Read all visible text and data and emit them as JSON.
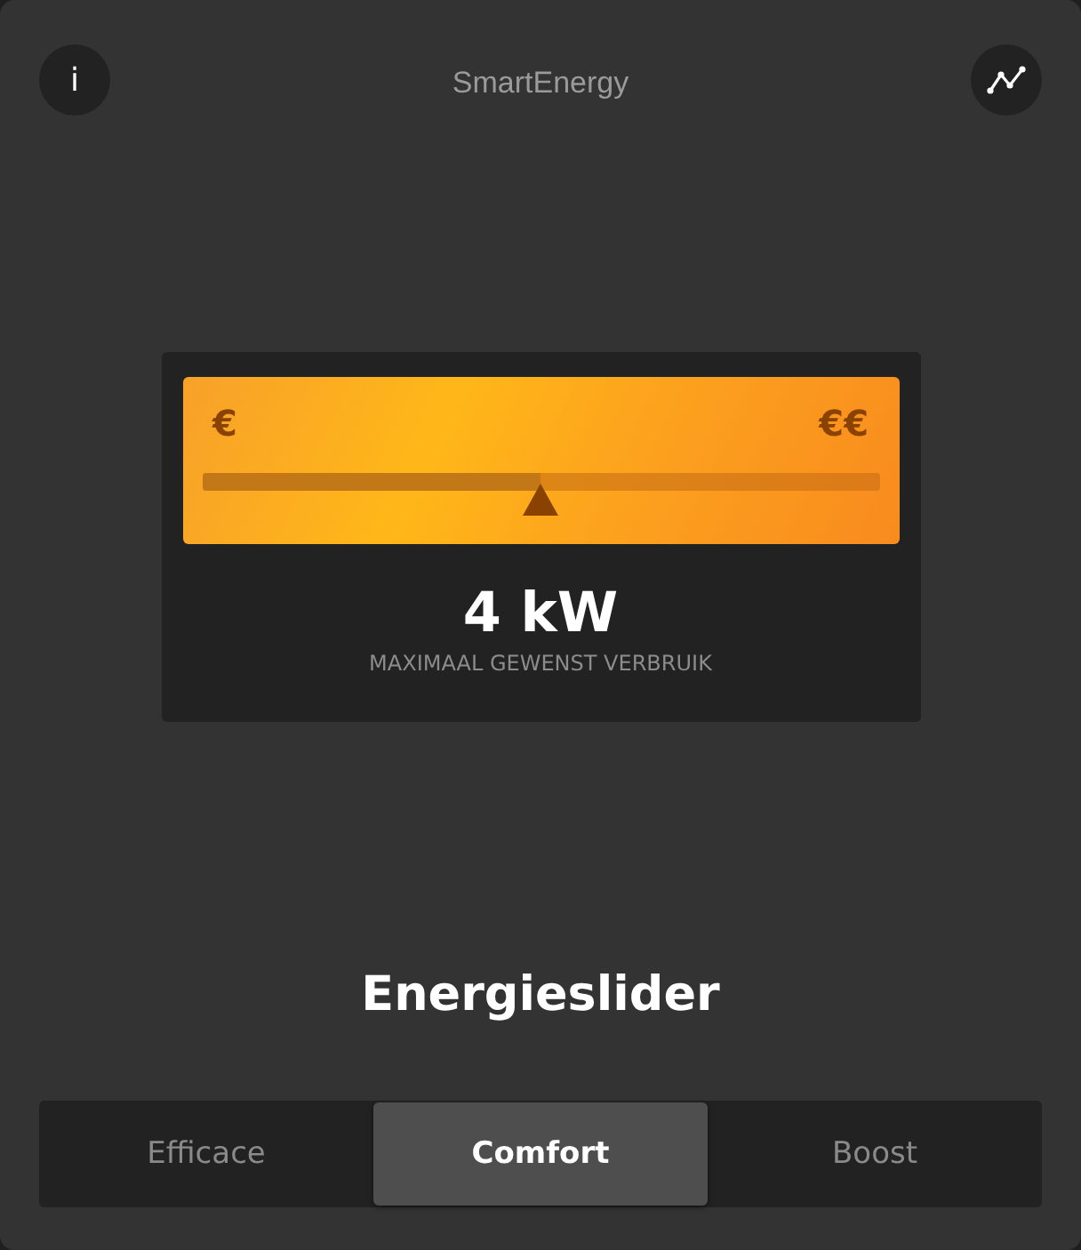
{
  "header": {
    "info_label": "i",
    "title": "SmartEnergy"
  },
  "slider": {
    "low_label": "€",
    "high_label": "€€",
    "level": 0.5
  },
  "reading": {
    "value": "4 kW",
    "caption": "MAXIMAAL GEWENST VERBRUIK"
  },
  "heading": "Energieslider",
  "modes": [
    {
      "label": "Efficace",
      "selected": false
    },
    {
      "label": "Comfort",
      "selected": true
    },
    {
      "label": "Boost",
      "selected": false
    }
  ]
}
